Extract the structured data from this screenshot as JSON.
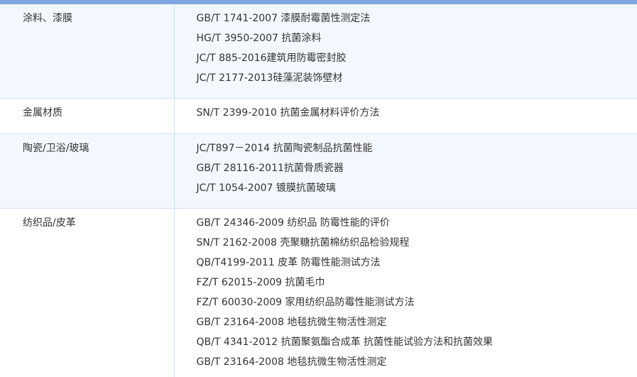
{
  "rows": [
    {
      "category": "涂料、漆膜",
      "items": [
        "GB/T 1741-2007 漆膜耐霉菌性测定法",
        "HG/T 3950-2007 抗菌涂料",
        "JC/T 885-2016建筑用防霉密封胶",
        "JC/T 2177-2013硅藻泥装饰壁材"
      ]
    },
    {
      "category": "金属材质",
      "items": [
        "SN/T 2399-2010  抗菌金属材料评价方法"
      ]
    },
    {
      "category": "陶瓷/卫浴/玻璃",
      "items": [
        "JC/T897－2014 抗菌陶瓷制品抗菌性能",
        "GB/T 28116-2011抗菌骨质瓷器",
        "JC/T 1054-2007 镀膜抗菌玻璃"
      ]
    },
    {
      "category": "纺织品/皮革",
      "items": [
        "GB/T 24346-2009  纺织品 防霉性能的评价",
        "SN/T 2162-2008 壳聚糖抗菌棉纺织品检验规程",
        "QB/T4199-2011 皮革 防霉性能测试方法",
        "FZ/T 62015-2009 抗菌毛巾",
        "FZ/T 60030-2009 家用纺织品防霉性能测试方法",
        "GB/T 23164-2008 地毯抗微生物活性测定",
        "QB/T 4341-2012 抗菌聚氨酯合成革 抗菌性能试验方法和抗菌效果",
        "GB/T 23164-2008  地毯抗微生物活性测定"
      ]
    }
  ]
}
